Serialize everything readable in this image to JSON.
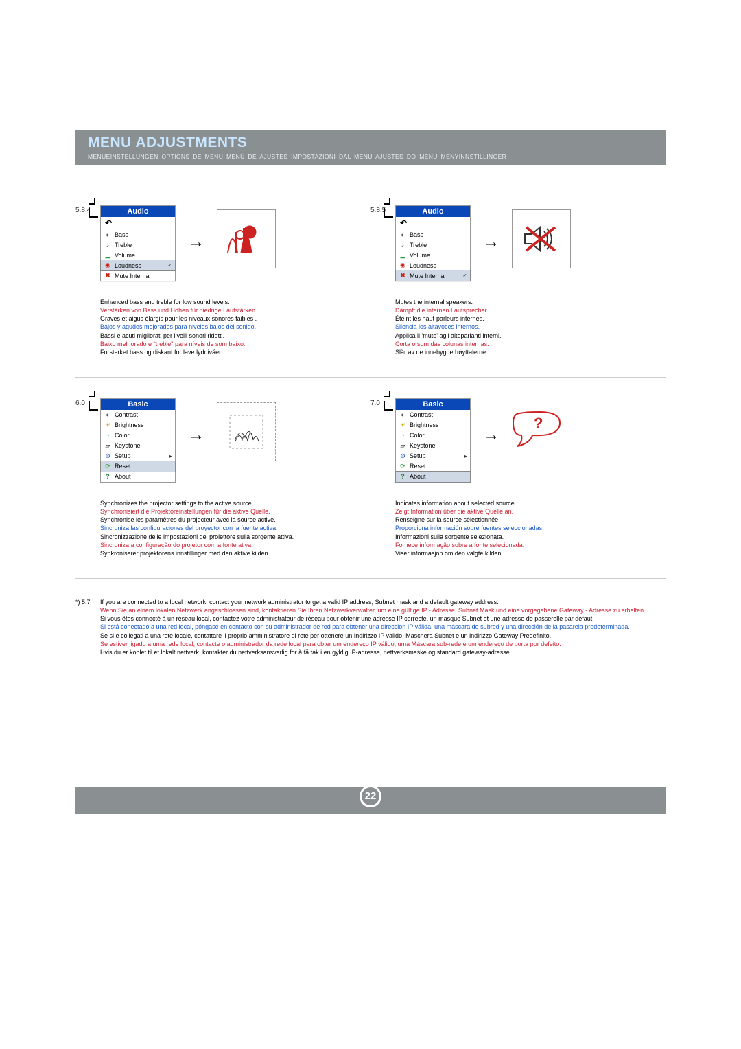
{
  "header": {
    "title": "MENU ADJUSTMENTS",
    "subtitle": "MENÜEINSTELLUNGEN   OPTIONS DE MENU   MENÚ DE AJUSTES   IMPOSTAZIONI DAL MENU   AJUSTES DO MENU   MENYINNSTILLINGER"
  },
  "panel_584": {
    "number": "5.8.4",
    "menu_title": "Audio",
    "items": [
      "Bass",
      "Treble",
      "Volume",
      "Loudness",
      "Mute Internal"
    ],
    "selected": "Loudness",
    "desc": {
      "en": "Enhanced bass and treble for low sound levels.",
      "de": "Verstärken von Bass und Höhen für niedrige Lautstärken.",
      "fr": "Graves et aigus élargis pour les niveaux sonores faibles .",
      "es": "Bajos y agudos mejorados para niveles bajos del sonido.",
      "it": "Bassi e acuti migliorati per livelli sonori ridotti.",
      "pt": "Baixo melhorado e \"treble\" para níveis de som baixo.",
      "no": "Forsterket bass og diskant for lave lydnivåer."
    }
  },
  "panel_585": {
    "number": "5.8.5",
    "menu_title": "Audio",
    "items": [
      "Bass",
      "Treble",
      "Volume",
      "Loudness",
      "Mute Internal"
    ],
    "selected": "Mute Internal",
    "desc": {
      "en": "Mutes the internal speakers.",
      "de": "Dämpft die internen Lautsprecher.",
      "fr": "Éteint les haut-parleurs internes.",
      "es": "Silencia los altavoces internos.",
      "it": "Applica il 'mute' agli altoparlanti interni.",
      "pt": "Corta o som das colunas internas.",
      "no": "Slår av de innebygde høyttalerne."
    }
  },
  "panel_60": {
    "number": "6.0",
    "menu_title": "Basic",
    "items": [
      "Contrast",
      "Brightness",
      "Color",
      "Keystone",
      "Setup",
      "Reset",
      "About"
    ],
    "selected": "Reset",
    "desc": {
      "en": "Synchronizes the projector settings to the active source.",
      "de": "Synchronisiert die Projektoreinstellungen für die aktive Quelle.",
      "fr": "Synchronise les paramètres du projecteur avec la source active.",
      "es": "Sincroniza las configuraciones del proyector con la fuente activa.",
      "it": "Sincronizzazione delle impostazioni del proiettore sulla sorgente attiva.",
      "pt": "Sincroniza a configuração do projetor com a fonte ativa.",
      "no": "Synkroniserer projektorens innstillinger med den aktive kilden."
    }
  },
  "panel_70": {
    "number": "7.0",
    "menu_title": "Basic",
    "items": [
      "Contrast",
      "Brightness",
      "Color",
      "Keystone",
      "Setup",
      "Reset",
      "About"
    ],
    "selected": "About",
    "desc": {
      "en": "Indicates information about selected source.",
      "de": "Zeigt Information über die aktive Quelle an.",
      "fr": "Renseigne sur la source sélectionnée.",
      "es": "Proporciona información sobre fuentes seleccionadas.",
      "it": "Informazioni sulla sorgente selezionata.",
      "pt": "Fornece informação sobre a fonte selecionada.",
      "no": "Viser informasjon om den valgte kilden."
    }
  },
  "footnote": {
    "tag": "*) 5.7",
    "en": "If you are connected to a local network, contact your network administrator to get a valid IP address, Subnet mask and a default gateway address.",
    "de": "Wenn Sie an einem lokalen Netzwerk angeschlossen sind, kontaktieren Sie Ihren Netzwerkverwalter, um eine gültige IP - Adresse, Subnet Mask und eine vorgegebene Gateway - Adresse zu erhalten.",
    "fr": "Si vous êtes connecté à un réseau local, contactez votre administrateur de réseau pour obtenir une adresse IP correcte, un masque Subnet et une adresse de passerelle par défaut.",
    "es": "Si está conectado a una red local, póngase en contacto con su administrador de red para obtener una dirección IP válida, una máscara de subred y una dirección de la pasarela predeterminada.",
    "it": "Se si è collegati a una rete locale, contattare il proprio amministratore di rete per ottenere un Indirizzo IP valido, Maschera Subnet e un indirizzo Gateway Predefinito.",
    "pt": "Se estiver ligado a uma rede local, contacte o administrador da rede local para obter um endereço IP válido, uma Máscara sub-rede e um endereço de porta por defeito.",
    "no": "Hvis du er koblet til et lokalt nettverk, kontakter du nettverksansvarlig for å få tak i en gyldig IP-adresse, nettverksmaske og standard gateway-adresse."
  },
  "page_number": "22"
}
